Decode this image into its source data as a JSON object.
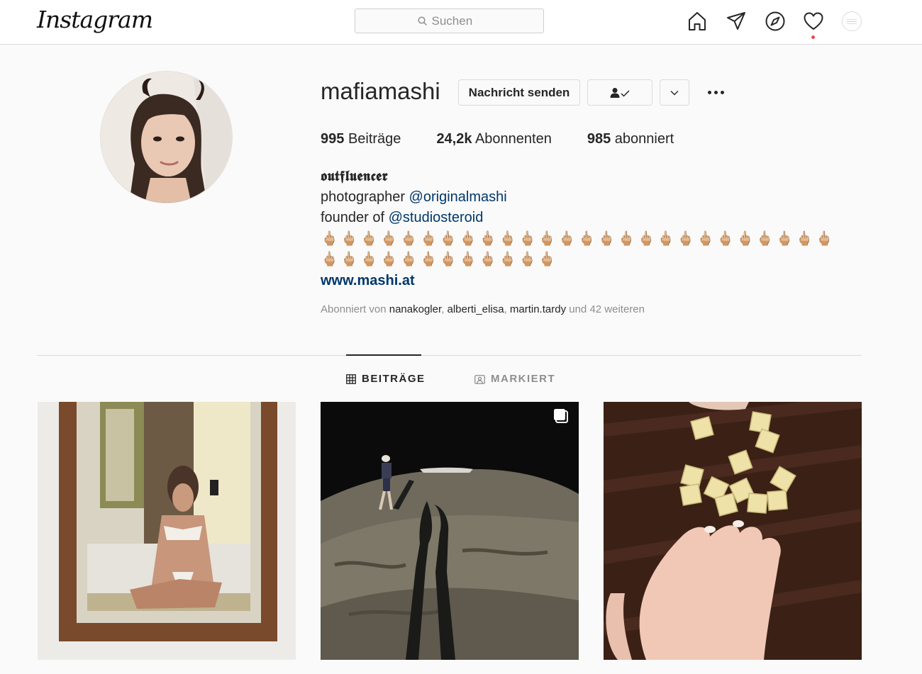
{
  "header": {
    "logo_text": "Instagram",
    "search_placeholder": "Suchen",
    "icons": [
      "home-icon",
      "direct-icon",
      "explore-icon",
      "activity-heart-icon",
      "profile-avatar"
    ]
  },
  "profile": {
    "username": "mafiamashi",
    "message_button": "Nachricht senden",
    "following_button_icon": "person-check-icon",
    "suggest_button_icon": "chevron-down-icon",
    "options_icon": "more-dots-icon",
    "stats": {
      "posts_count": "995",
      "posts_label": "Beiträge",
      "followers_count": "24,2k",
      "followers_label": "Abonnenten",
      "following_count": "985",
      "following_label": "abonniert"
    },
    "bio": {
      "name": "𝖔𝖚𝖙𝖋𝖑𝖚𝖊𝖓𝖈𝖊𝖗",
      "line1_text": "photographer ",
      "line1_link": "@originalmashi",
      "line2_text": "founder of ",
      "line2_link": "@studiosteroid",
      "emoji_row1": "🖕🏼🖕🏼🖕🏼🖕🏼🖕🏼🖕🏼🖕🏼🖕🏼🖕🏼🖕🏼🖕🏼🖕🏼🖕🏼🖕🏼🖕🏼🖕🏼🖕🏼🖕🏼🖕🏼🖕🏼🖕🏼🖕🏼🖕🏼🖕🏼🖕🏼🖕🏼",
      "emoji_row2": "🖕🏼🖕🏼🖕🏼🖕🏼🖕🏼🖕🏼🖕🏼🖕🏼🖕🏼🖕🏼🖕🏼🖕🏼",
      "website": "www.mashi.at"
    },
    "followed_by": {
      "prefix": "Abonniert von ",
      "user1": "nanakogler",
      "sep1": ", ",
      "user2": "alberti_elisa",
      "sep2": ", ",
      "user3": "martin.tardy",
      "suffix": " und 42 weiteren"
    }
  },
  "tabs": {
    "posts_label": "BEITRÄGE",
    "tagged_label": "MARKIERT"
  },
  "posts": [
    {
      "description": "mirror-selfie-photo"
    },
    {
      "description": "night-beach-photo",
      "badge_icon": "carousel-icon"
    },
    {
      "description": "scrabble-tiles-photo"
    }
  ],
  "colors": {
    "link": "#00376b",
    "notification_dot": "#ed4956",
    "muted_text": "#8e8e8e",
    "border": "#dbdbdb"
  }
}
